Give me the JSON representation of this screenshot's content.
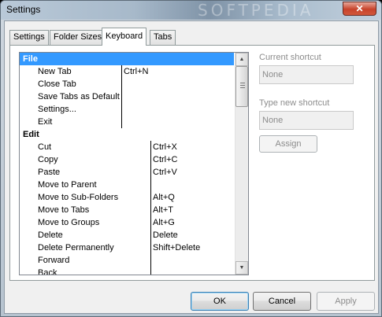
{
  "window": {
    "title": "Settings",
    "close_glyph": "✕",
    "watermark": "SOFTPEDIA"
  },
  "tabs": [
    {
      "label": "Settings",
      "active": false
    },
    {
      "label": "Folder Sizes",
      "active": false
    },
    {
      "label": "Keyboard",
      "active": true
    },
    {
      "label": "Tabs",
      "active": false
    }
  ],
  "commands": {
    "groups": [
      {
        "name": "File",
        "selected": true,
        "items": [
          {
            "name": "New Tab",
            "shortcut": "Ctrl+N"
          },
          {
            "name": "Close Tab",
            "shortcut": ""
          },
          {
            "name": "Save Tabs as Default",
            "shortcut": ""
          },
          {
            "name": "Settings...",
            "shortcut": ""
          },
          {
            "name": "Exit",
            "shortcut": ""
          }
        ]
      },
      {
        "name": "Edit",
        "selected": false,
        "items": [
          {
            "name": "Cut",
            "shortcut": "Ctrl+X"
          },
          {
            "name": "Copy",
            "shortcut": "Ctrl+C"
          },
          {
            "name": "Paste",
            "shortcut": "Ctrl+V"
          },
          {
            "name": "Move to Parent",
            "shortcut": ""
          },
          {
            "name": "Move to Sub-Folders",
            "shortcut": "Alt+Q"
          },
          {
            "name": "Move to Tabs",
            "shortcut": "Alt+T"
          },
          {
            "name": "Move to Groups",
            "shortcut": "Alt+G"
          },
          {
            "name": "Delete",
            "shortcut": "Delete"
          },
          {
            "name": "Delete Permanently",
            "shortcut": "Shift+Delete"
          },
          {
            "name": "Forward",
            "shortcut": ""
          },
          {
            "name": "Back",
            "shortcut": ""
          }
        ]
      }
    ]
  },
  "shortcut_panel": {
    "current_label": "Current shortcut",
    "current_value": "None",
    "new_label": "Type new shortcut",
    "new_value": "None",
    "assign_label": "Assign"
  },
  "buttons": {
    "ok": "OK",
    "cancel": "Cancel",
    "apply": "Apply"
  },
  "colors": {
    "selection": "#3399ff",
    "default_button_border": "#3c7fb1"
  }
}
